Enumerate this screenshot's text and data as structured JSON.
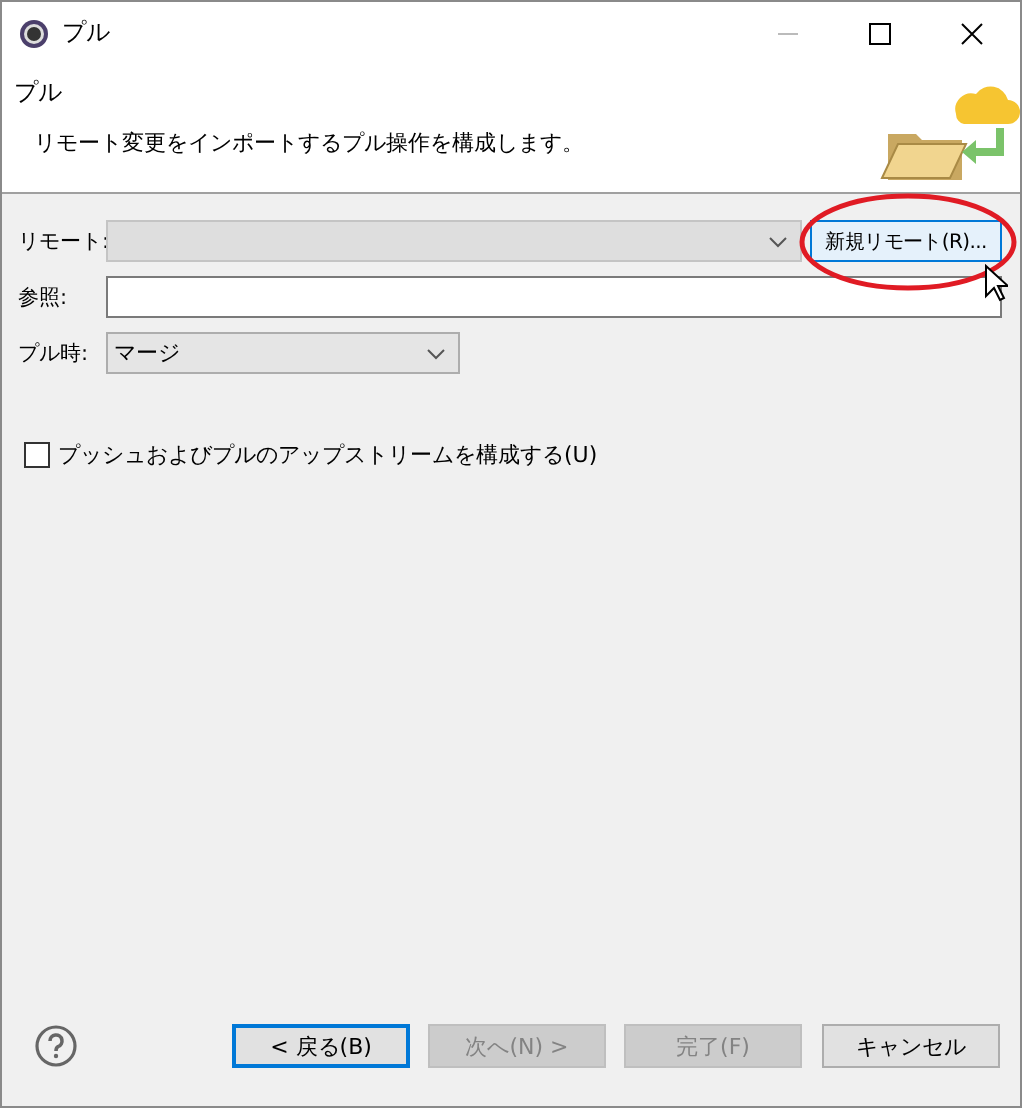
{
  "window": {
    "title": "プル"
  },
  "header": {
    "title": "プル",
    "description": "リモート変更をインポートするプル操作を構成します。"
  },
  "fields": [
    {
      "kind": "combo",
      "label": "リモート:",
      "disabled": true,
      "button": "新規リモート(R)..."
    },
    {
      "kind": "text",
      "label": "参照:",
      "disabled": false
    },
    {
      "kind": "combo",
      "label": "プル時:",
      "value": "マージ",
      "disabled": false
    }
  ],
  "checkbox": {
    "label": "プッシュおよびプルのアップストリームを構成する(U)",
    "checked": false
  },
  "buttons": [
    {
      "label": "< 戻る(B)",
      "disabled": false,
      "focused": true
    },
    {
      "label": "次へ(N) >",
      "disabled": true,
      "focused": false
    },
    {
      "label": "完了(F)",
      "disabled": true,
      "focused": false
    },
    {
      "label": "キャンセル",
      "disabled": false,
      "focused": false
    }
  ]
}
